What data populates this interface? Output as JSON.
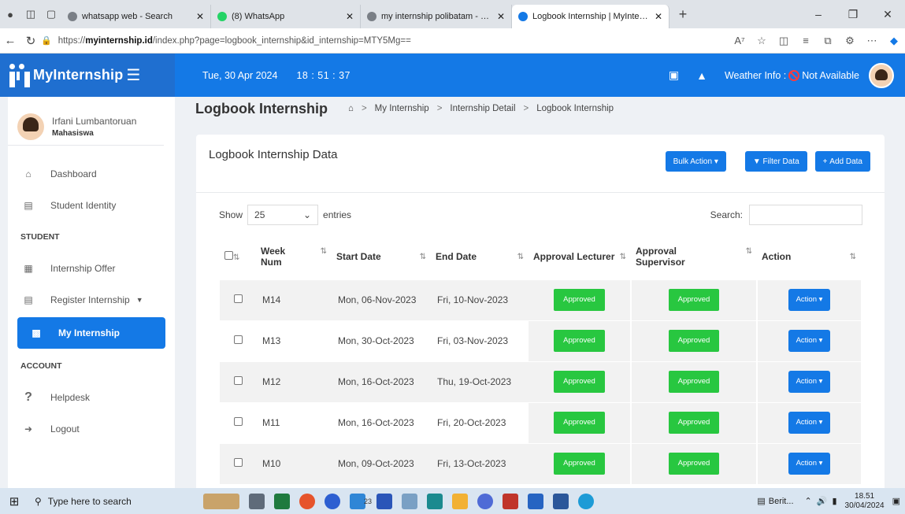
{
  "browser": {
    "tabs": [
      {
        "label": "whatsapp web - Search",
        "icon_color": "#7a7f86"
      },
      {
        "label": "(8) WhatsApp",
        "icon_color": "#25d366"
      },
      {
        "label": "my internship polibatam - Search",
        "icon_color": "#7a7f86"
      },
      {
        "label": "Logbook Internship | MyInternship",
        "icon_color": "#1479e6"
      }
    ],
    "new_tab": "+",
    "url_prefix": "https://",
    "url_host": "myinternship.id",
    "url_path": "/index.php?page=logbook_internship&id_internship=MTY5Mg=="
  },
  "app": {
    "brand": "MyInternship",
    "date": "Tue, 30 Apr 2024",
    "time": "18 : 51 : 37",
    "weather_label": "Weather Info :",
    "weather_value": "Not Available"
  },
  "profile": {
    "name": "Irfani Lumbantoruan",
    "role": "Mahasiswa"
  },
  "menu": {
    "dashboard": "Dashboard",
    "student_identity": "Student Identity",
    "section_student": "STUDENT",
    "internship_offer": "Internship Offer",
    "register_internship": "Register Internship",
    "my_internship": "My Internship",
    "section_account": "ACCOUNT",
    "helpdesk": "Helpdesk",
    "logout": "Logout"
  },
  "page": {
    "title": "Logbook Internship",
    "breadcrumb": [
      "My Internship",
      "Internship Detail",
      "Logbook Internship"
    ]
  },
  "card": {
    "title": "Logbook Internship Data",
    "bulk_action": "Bulk Action",
    "filter": "Filter Data",
    "add": "Add Data",
    "show": "Show",
    "entries_value": "25",
    "entries": "entries",
    "search": "Search:"
  },
  "table": {
    "headers": {
      "week": "Week Num",
      "start": "Start Date",
      "end": "End Date",
      "lecturer": "Approval Lecturer",
      "supervisor": "Approval Supervisor",
      "action": "Action"
    },
    "rows": [
      {
        "week": "M14",
        "start": "Mon, 06-Nov-2023",
        "end": "Fri, 10-Nov-2023",
        "lecturer": "Approved",
        "supervisor": "Approved",
        "action": "Action"
      },
      {
        "week": "M13",
        "start": "Mon, 30-Oct-2023",
        "end": "Fri, 03-Nov-2023",
        "lecturer": "Approved",
        "supervisor": "Approved",
        "action": "Action"
      },
      {
        "week": "M12",
        "start": "Mon, 16-Oct-2023",
        "end": "Thu, 19-Oct-2023",
        "lecturer": "Approved",
        "supervisor": "Approved",
        "action": "Action"
      },
      {
        "week": "M11",
        "start": "Mon, 16-Oct-2023",
        "end": "Fri, 20-Oct-2023",
        "lecturer": "Approved",
        "supervisor": "Approved",
        "action": "Action"
      },
      {
        "week": "M10",
        "start": "Mon, 09-Oct-2023",
        "end": "Fri, 13-Oct-2023",
        "lecturer": "Approved",
        "supervisor": "Approved",
        "action": "Action"
      }
    ]
  },
  "taskbar": {
    "search_placeholder": "Type here to search",
    "news": "Berit...",
    "time": "18.51",
    "date": "30/04/2024",
    "badge": "23"
  },
  "colors": {
    "primary": "#1479e6",
    "approved": "#28c740",
    "brand_bg": "#1f6fd0"
  }
}
